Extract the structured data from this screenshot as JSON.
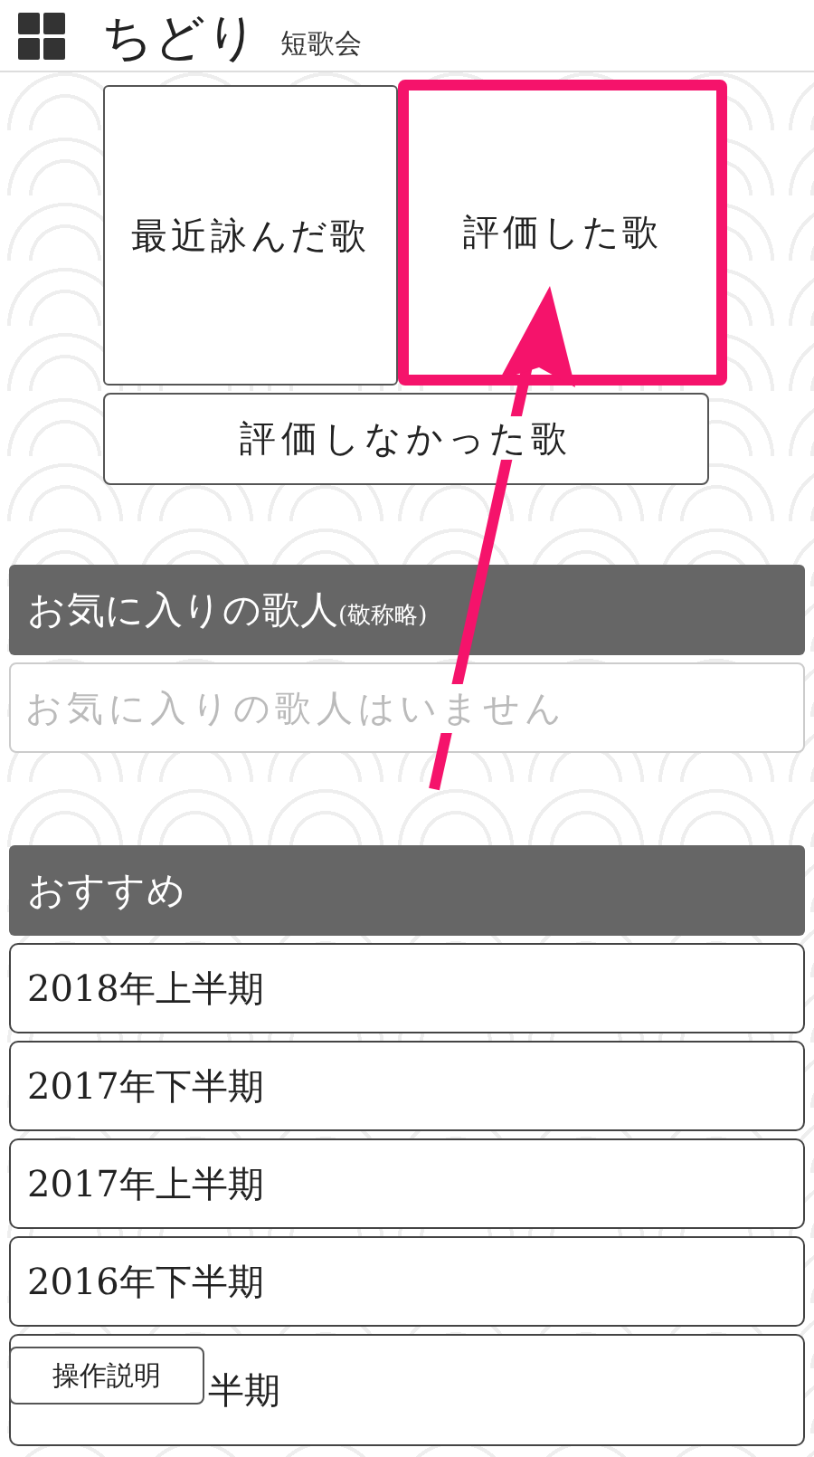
{
  "header": {
    "title": "ちどり",
    "subtitle": "短歌会"
  },
  "song_buttons": [
    {
      "label": "最近詠んだ歌",
      "highlighted": false
    },
    {
      "label": "評価した歌",
      "highlighted": true
    }
  ],
  "wide_button": {
    "label": "評価しなかった歌"
  },
  "favorites": {
    "heading": "お気に入りの歌人",
    "heading_note": "(敬称略)",
    "empty_text": "お気に入りの歌人はいません"
  },
  "recommended": {
    "heading": "おすすめ",
    "items": [
      {
        "label": "2018年上半期"
      },
      {
        "label": "2017年下半期"
      },
      {
        "label": "2017年上半期"
      },
      {
        "label": "2016年下半期"
      },
      {
        "label": "半期"
      }
    ]
  },
  "help_button": {
    "label": "操作説明"
  }
}
